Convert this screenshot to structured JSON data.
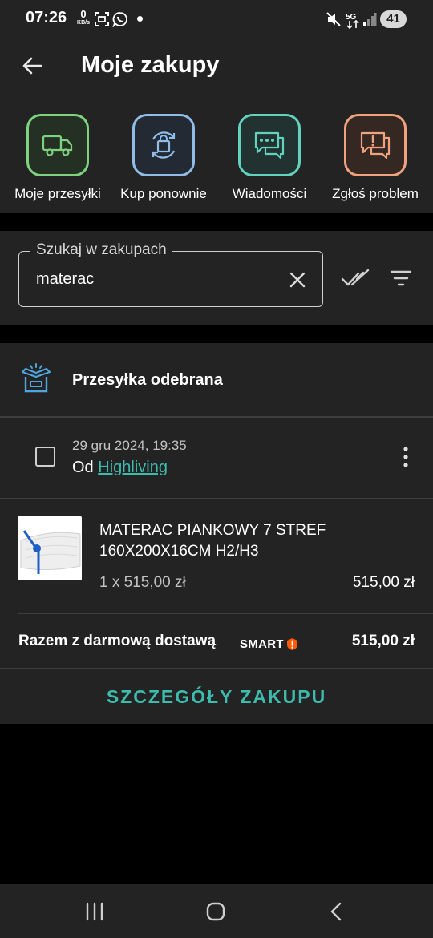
{
  "status_bar": {
    "time": "07:26",
    "net_speed_value": "0",
    "net_speed_unit": "KB/s",
    "battery": "41"
  },
  "header": {
    "title": "Moje zakupy"
  },
  "quick_actions": [
    {
      "label": "Moje przesyłki",
      "icon": "truck-icon",
      "color": "#7ed27e"
    },
    {
      "label": "Kup ponownie",
      "icon": "repeat-bag-icon",
      "color": "#8fbde8"
    },
    {
      "label": "Wiadomości",
      "icon": "chat-icon",
      "color": "#62d2bf"
    },
    {
      "label": "Zgłoś problem",
      "icon": "report-chat-icon",
      "color": "#f0a27e"
    }
  ],
  "search": {
    "label": "Szukaj w zakupach",
    "value": "materac"
  },
  "order": {
    "shipment_status": "Przesyłka odebrana",
    "date": "29 gru 2024, 19:35",
    "seller_prefix": "Od",
    "seller_name": "Highliving",
    "product": {
      "name": "MATERAC PIANKOWY 7 STREF 160X200X16CM H2/H3",
      "quantity_price": "1 x 515,00 zł",
      "price": "515,00 zł"
    },
    "total_label": "Razem z darmową dostawą",
    "smart_label": "SMART",
    "total_value": "515,00 zł",
    "details_button": "SZCZEGÓŁY ZAKUPU"
  },
  "colors": {
    "accent": "#3dbcae",
    "card_background": "#232323",
    "page_background": "#000000"
  }
}
